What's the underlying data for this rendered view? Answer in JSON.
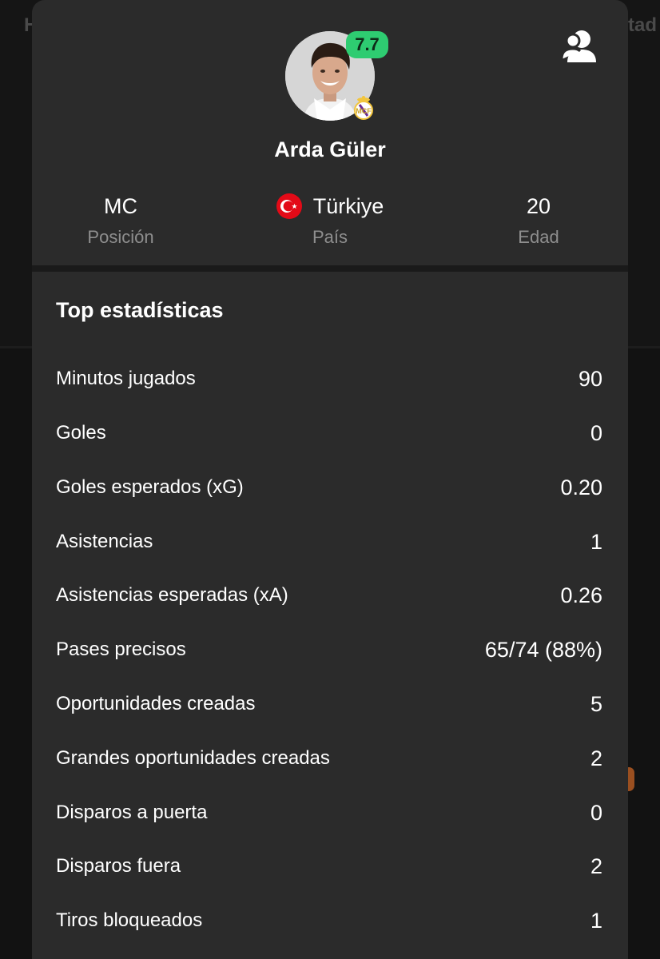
{
  "background": {
    "fragment_left": "H",
    "fragment_right": "tad"
  },
  "player": {
    "name": "Arda Güler",
    "rating": "7.7",
    "club_badge": "real-madrid-crest-icon",
    "follow_icon": "follow-user-icon"
  },
  "info": [
    {
      "value": "MC",
      "label": "Posición"
    },
    {
      "value": "Türkiye",
      "label": "País",
      "flag": "turkey-flag-icon"
    },
    {
      "value": "20",
      "label": "Edad"
    }
  ],
  "stats": {
    "title": "Top estadísticas",
    "rows": [
      {
        "label": "Minutos jugados",
        "value": "90"
      },
      {
        "label": "Goles",
        "value": "0"
      },
      {
        "label": "Goles esperados (xG)",
        "value": "0.20"
      },
      {
        "label": "Asistencias",
        "value": "1"
      },
      {
        "label": "Asistencias esperadas (xA)",
        "value": "0.26"
      },
      {
        "label": "Pases precisos",
        "value": "65/74 (88%)"
      },
      {
        "label": "Oportunidades creadas",
        "value": "5"
      },
      {
        "label": "Grandes oportunidades creadas",
        "value": "2"
      },
      {
        "label": "Disparos a puerta",
        "value": "0"
      },
      {
        "label": "Disparos fuera",
        "value": "2"
      },
      {
        "label": "Tiros bloqueados",
        "value": "1"
      }
    ]
  },
  "colors": {
    "sheet": "#2b2b2b",
    "rating_green": "#2ecc71",
    "label_gray": "#8e8e8e",
    "flag_red": "#e30a17"
  }
}
